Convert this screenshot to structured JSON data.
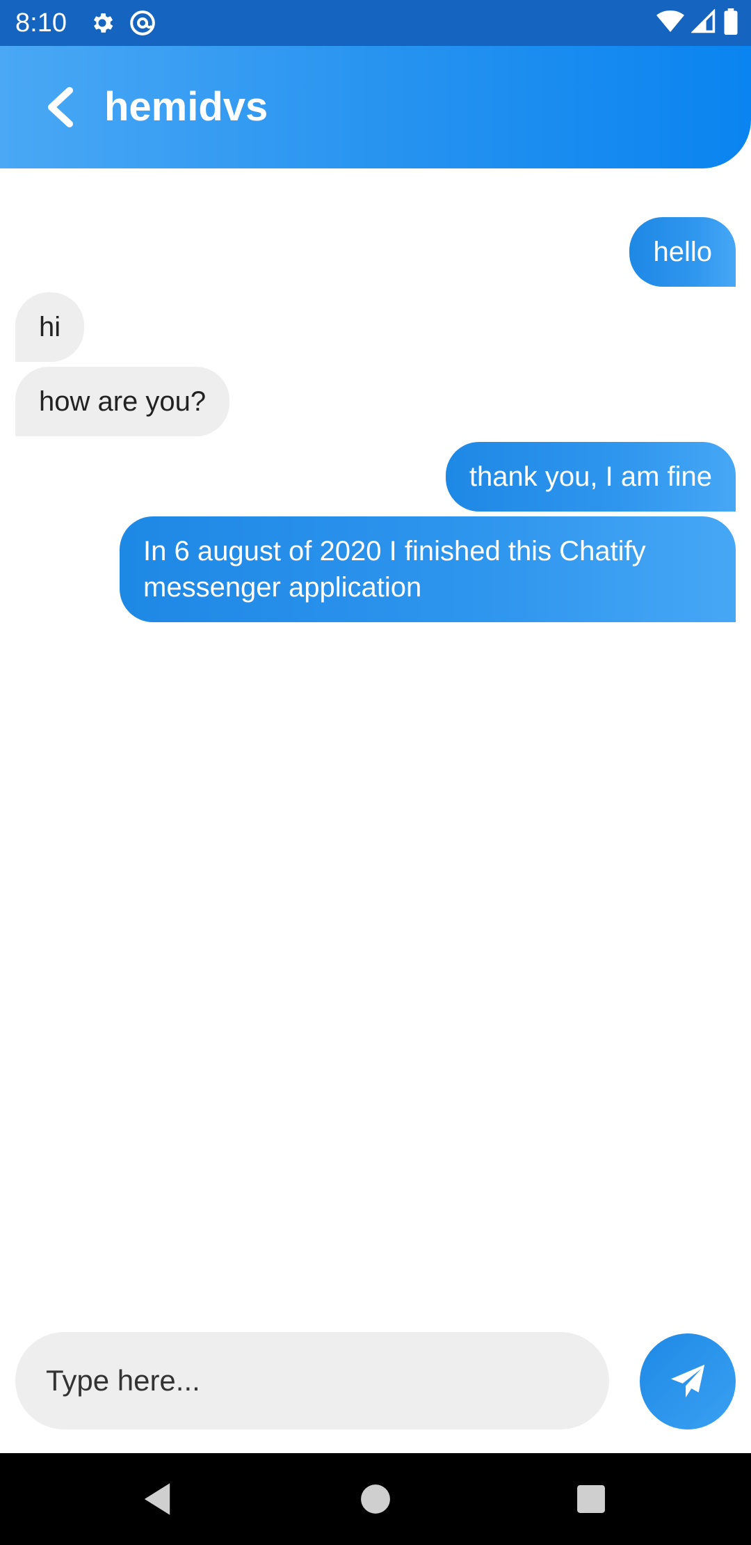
{
  "status_bar": {
    "time": "8:10",
    "icons_left": [
      "gear-icon",
      "at-sign-icon"
    ],
    "icons_right": [
      "wifi-icon",
      "signal-icon",
      "battery-icon"
    ]
  },
  "header": {
    "title": "hemidvs",
    "back_icon": "chevron-left-icon",
    "gradient": [
      "#4aa8f5",
      "#0a84f0"
    ]
  },
  "messages": [
    {
      "direction": "out",
      "text": "hello"
    },
    {
      "direction": "in",
      "text": "hi"
    },
    {
      "direction": "in",
      "text": "how are you?"
    },
    {
      "direction": "out",
      "text": "thank you, I am fine"
    },
    {
      "direction": "out",
      "text_line1": "In 6 august of 2020 I finished this Chatify",
      "text_line2": "messenger application"
    }
  ],
  "composer": {
    "placeholder": "Type here...",
    "send_icon": "paper-plane-icon"
  },
  "nav_bar": {
    "icons": [
      "back-triangle-icon",
      "home-circle-icon",
      "recents-square-icon"
    ]
  },
  "colors": {
    "outgoing_bubble": "#1e88e5",
    "incoming_bubble": "#eeeeee",
    "status_bar": "#1565c0"
  }
}
